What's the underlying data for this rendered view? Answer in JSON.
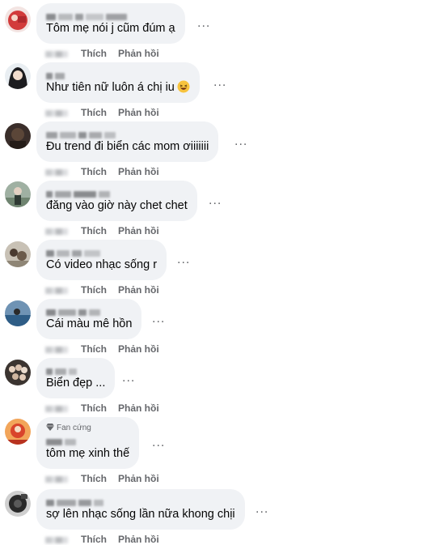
{
  "actions": {
    "like_label": "Thích",
    "reply_label": "Phản hồi",
    "more_label": "..."
  },
  "comments": [
    {
      "text": "Tôm mẹ nói j cũm đúm ạ"
    },
    {
      "text": "Như tiên nữ luôn á chị iu"
    },
    {
      "text": "Đu trend đi biển các mom ơiiiiiii"
    },
    {
      "text": "đăng vào giờ này chet chet"
    },
    {
      "text": "Có video nhạc sống r"
    },
    {
      "text": "Cái màu mê hồn"
    },
    {
      "text": "Biển đẹp ..."
    },
    {
      "text": "tôm mẹ xinh thế",
      "badge": "Fan cứng"
    },
    {
      "text": "sợ lên nhạc sống lần nữa khong chịi"
    }
  ]
}
